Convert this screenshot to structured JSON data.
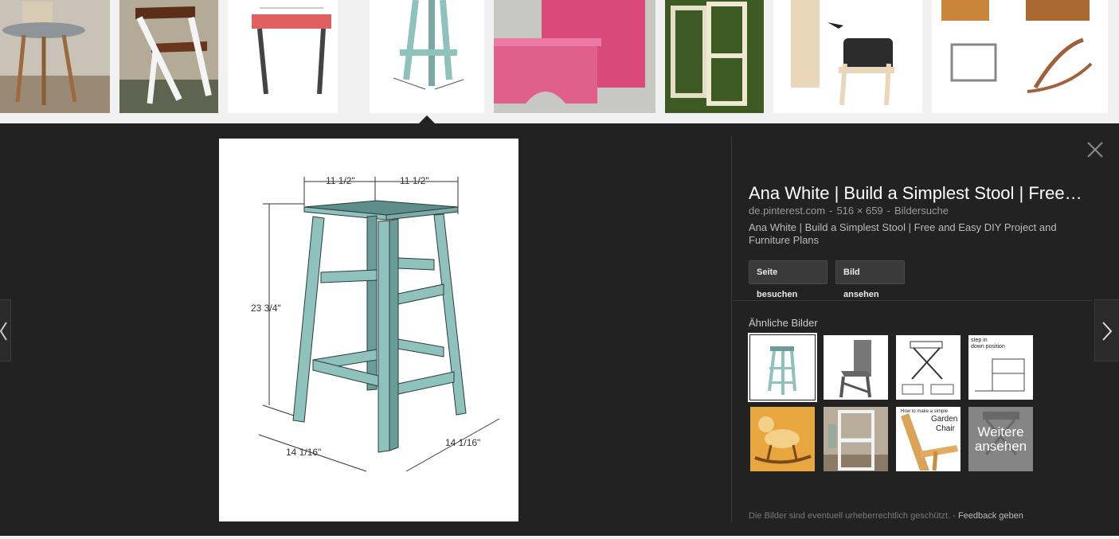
{
  "preview": {
    "title": "Ana White | Build a Simplest Stool | Free and Easy DIY Project and Furniture Plans",
    "source": "de.pinterest.com",
    "dimensions": "516 × 659",
    "search_type": "Bildersuche",
    "description": "Ana White | Build a Simplest Stool | Free and Easy DIY Project and Furniture Plans",
    "visit_button": "Seite besuchen",
    "view_button": "Bild ansehen",
    "diagram_labels": {
      "top_left": "11 1/2\"",
      "top_right": "11 1/2\"",
      "height": "23 3/4\"",
      "bottom_left": "14 1/16\"",
      "bottom_right": "14 1/16\""
    }
  },
  "similar": {
    "title": "Ähnliche Bilder",
    "more_label_line1": "Weitere",
    "more_label_line2": "ansehen",
    "garden_caption_small": "How to make a simple",
    "garden_caption_line1": "Garden",
    "garden_caption_line2": "Chair",
    "step_caption_line1": "step in",
    "step_caption_line2": "down position"
  },
  "footer": {
    "notice": "Die Bilder sind eventuell urheberrechtlich geschützt.",
    "separator": "-",
    "feedback": "Feedback geben"
  },
  "colors": {
    "panel_bg": "#222222",
    "stool": "#8fc1bd",
    "stool_dark": "#6a9c98",
    "accent_pink": "#d94a7a"
  }
}
